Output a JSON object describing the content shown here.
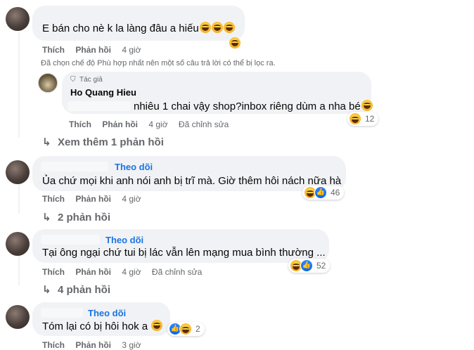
{
  "comments": [
    {
      "text": "E bán cho nè k la làng đâu a hiếu",
      "actions": {
        "like": "Thích",
        "reply": "Phản hồi",
        "time": "4 giờ"
      },
      "filter_note": "Đã chọn chế độ Phù hợp nhất nên một số câu trả lời có thể bị lọc ra."
    },
    {
      "author_badge": "Tác giả",
      "author": "Ho Quang Hieu",
      "text": "nhiêu 1 chai vậy shop?inbox riêng dùm a nha bé",
      "reaction_count": "12",
      "actions": {
        "like": "Thích",
        "reply": "Phản hồi",
        "time": "4 giờ",
        "edited": "Đã chỉnh sửa"
      },
      "more_replies": "Xem thêm 1 phản hồi"
    },
    {
      "follow": "Theo dõi",
      "text": "Ủa chứ mọi khi anh nói anh bị trĩ mà. Giờ thêm hôi nách nữa hà",
      "reaction_count": "46",
      "actions": {
        "like": "Thích",
        "reply": "Phản hồi",
        "time": "4 giờ"
      },
      "more_replies": "2 phản hồi"
    },
    {
      "follow": "Theo dõi",
      "text": "Tại ông ngại chứ tui bị lác vẫn lên mạng mua bình thường ...",
      "reaction_count": "52",
      "actions": {
        "like": "Thích",
        "reply": "Phản hồi",
        "time": "4 giờ",
        "edited": "Đã chỉnh sửa"
      },
      "more_replies": "4 phản hồi"
    },
    {
      "follow": "Theo dõi",
      "text": "Tóm lại có bị hôi hok a",
      "reaction_count": "2",
      "actions": {
        "like": "Thích",
        "reply": "Phản hồi",
        "time": "3 giờ"
      }
    }
  ],
  "icons": {
    "reaction": "haha-emoji-icon",
    "like": "like-icon",
    "reply_arrow": "reply-arrow-icon"
  },
  "colors": {
    "link_blue": "#1b74e4",
    "bubble": "#f0f2f5",
    "meta": "#65676b"
  }
}
